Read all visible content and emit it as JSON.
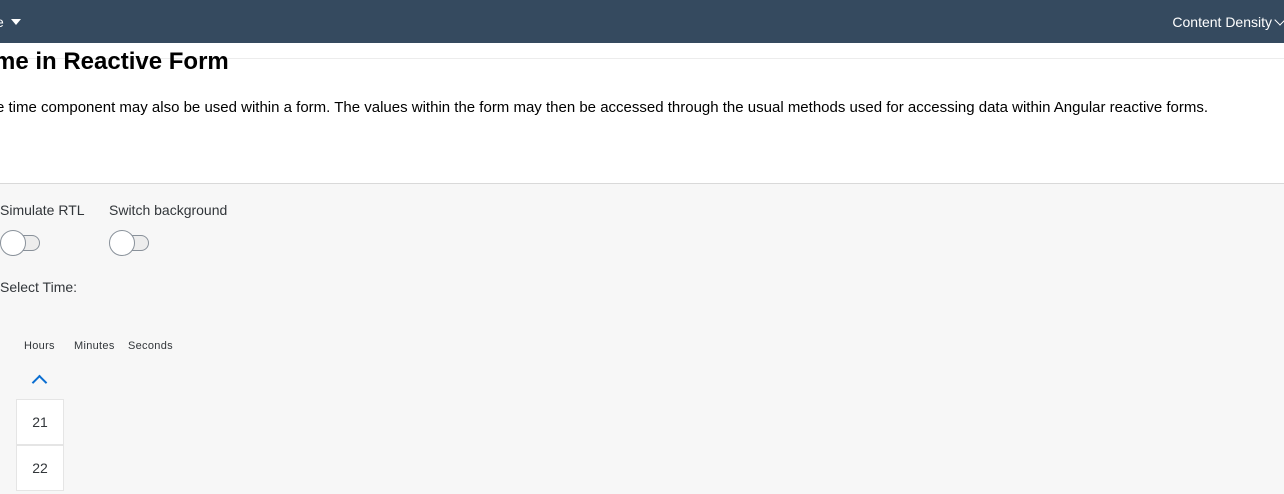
{
  "shell": {
    "left_text": "e",
    "right_label": "Content Density"
  },
  "section": {
    "title": "me in Reactive Form",
    "description": "e time component may also be used within a form. The values within the form may then be accessed through the usual methods used for accessing data within Angular reactive forms."
  },
  "toggles": [
    {
      "label": "Simulate RTL",
      "on": false
    },
    {
      "label": "Switch background",
      "on": false
    }
  ],
  "time_picker": {
    "label": "Select Time:",
    "columns": [
      "Hours",
      "Minutes",
      "Seconds"
    ],
    "hour_values": [
      "21",
      "22"
    ]
  }
}
